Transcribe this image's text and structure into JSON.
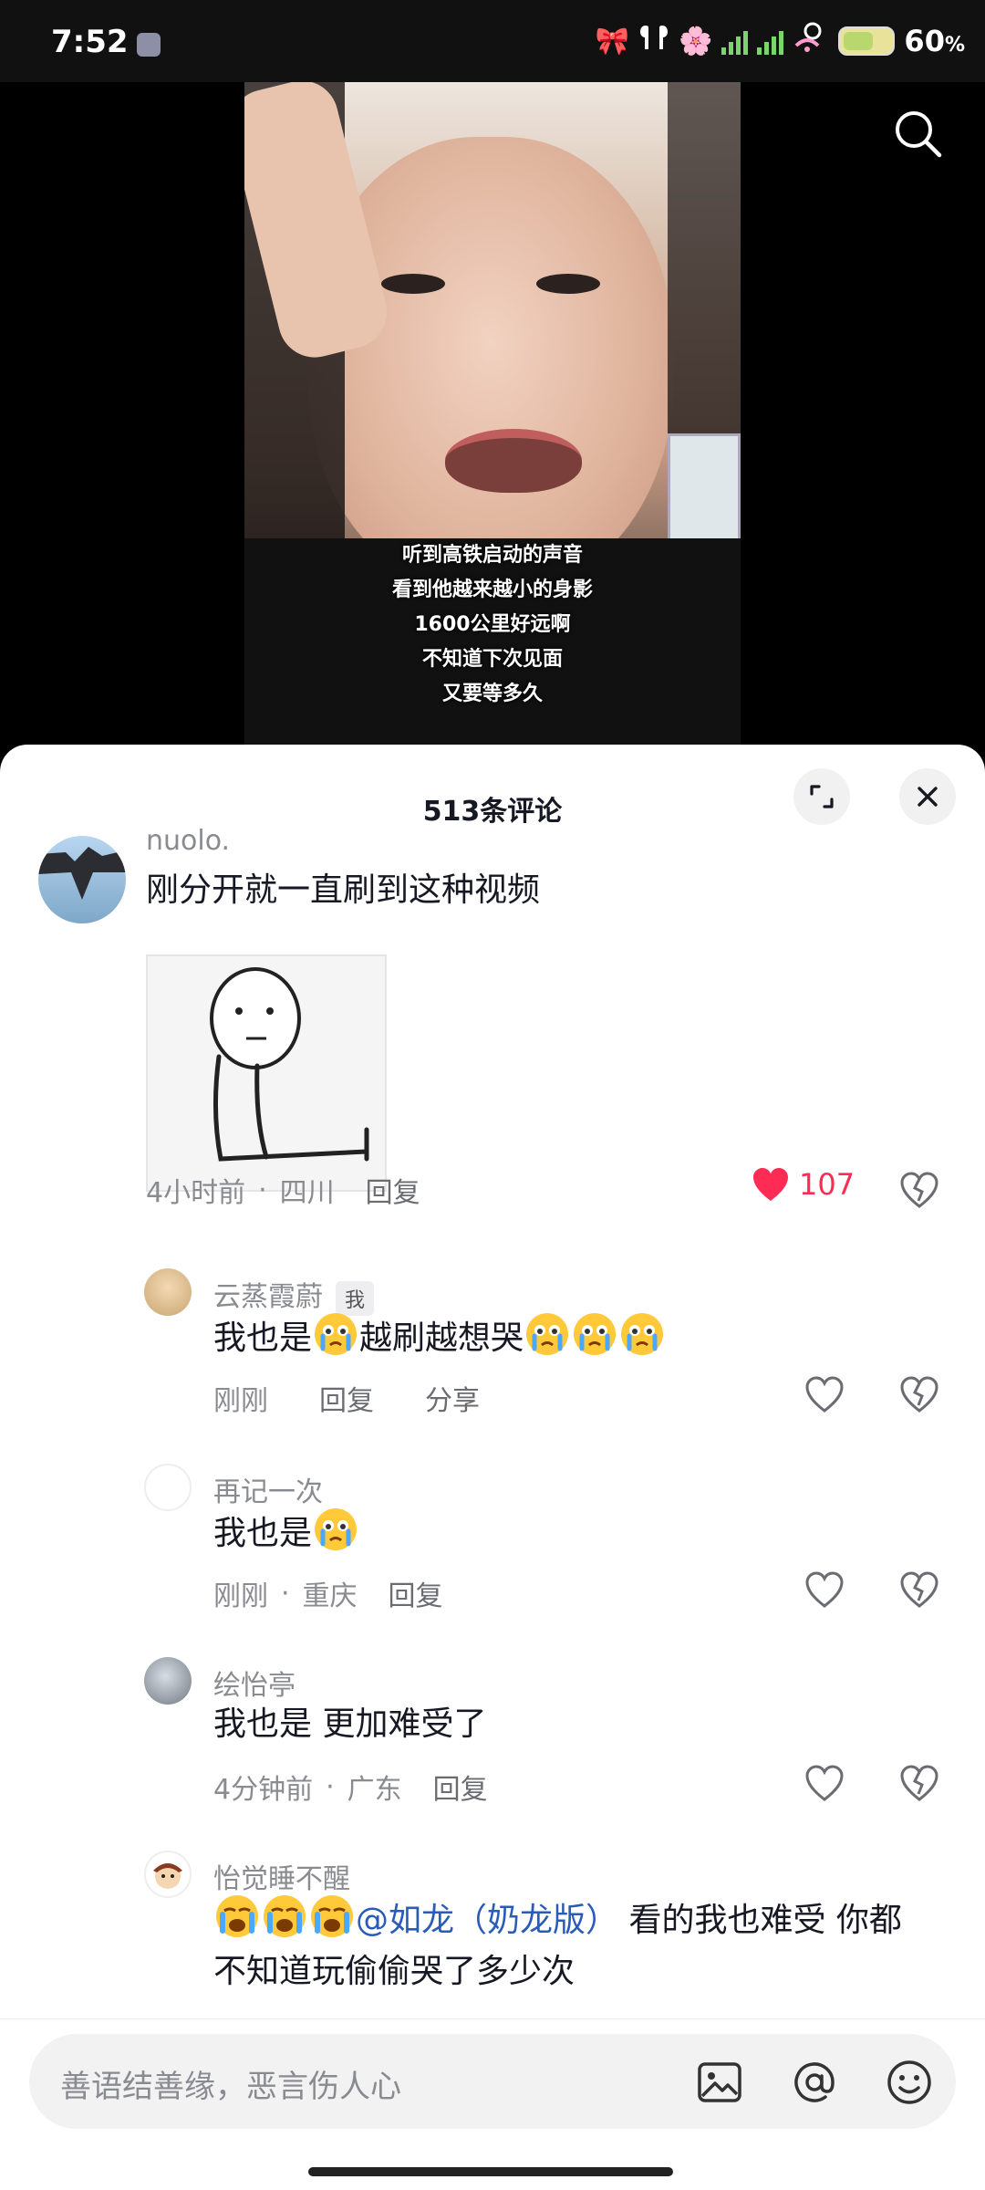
{
  "status_bar": {
    "time": "7:52",
    "battery": "60",
    "battery_unit": "%"
  },
  "video": {
    "caption_lines": [
      "听到高铁启动的声音",
      "看到他越来越小的身影",
      "1600公里好远啊",
      "不知道下次见面",
      "又要等多久"
    ]
  },
  "comments_panel": {
    "title": "513条评论",
    "comments": [
      {
        "username": "nuolo.",
        "text": "刚分开就一直刷到这种视频",
        "time": "4小时前",
        "location": "四川",
        "reply": "回复",
        "likes": "107"
      },
      {
        "username": "云蒸霞蔚",
        "badge": "我",
        "text_a": "我也是",
        "text_b": "越刷越想哭",
        "time": "刚刚",
        "reply": "回复",
        "share": "分享"
      },
      {
        "username": "再记一次",
        "text": "我也是",
        "time": "刚刚",
        "location": "重庆",
        "reply": "回复"
      },
      {
        "username": "绘怡亭",
        "text": "我也是 更加难受了",
        "time": "4分钟前",
        "location": "广东",
        "reply": "回复"
      },
      {
        "username": "怡觉睡不醒",
        "mention": "@如龙（奶龙版）",
        "text_a": " 看的我也难受 你都",
        "text_b": "不知道玩偷偷哭了多少次"
      }
    ]
  },
  "input": {
    "placeholder": "善语结善缘，恶言伤人心"
  },
  "colors": {
    "like_red": "#fe2c55",
    "mention_blue": "#2a5bb8",
    "text_gray": "#8a8b91"
  },
  "icons": [
    "search-icon",
    "expand-icon",
    "close-icon",
    "heart-icon",
    "dislike-heart-icon",
    "image-icon",
    "at-icon",
    "emoji-icon",
    "crying-emoji-icon"
  ]
}
